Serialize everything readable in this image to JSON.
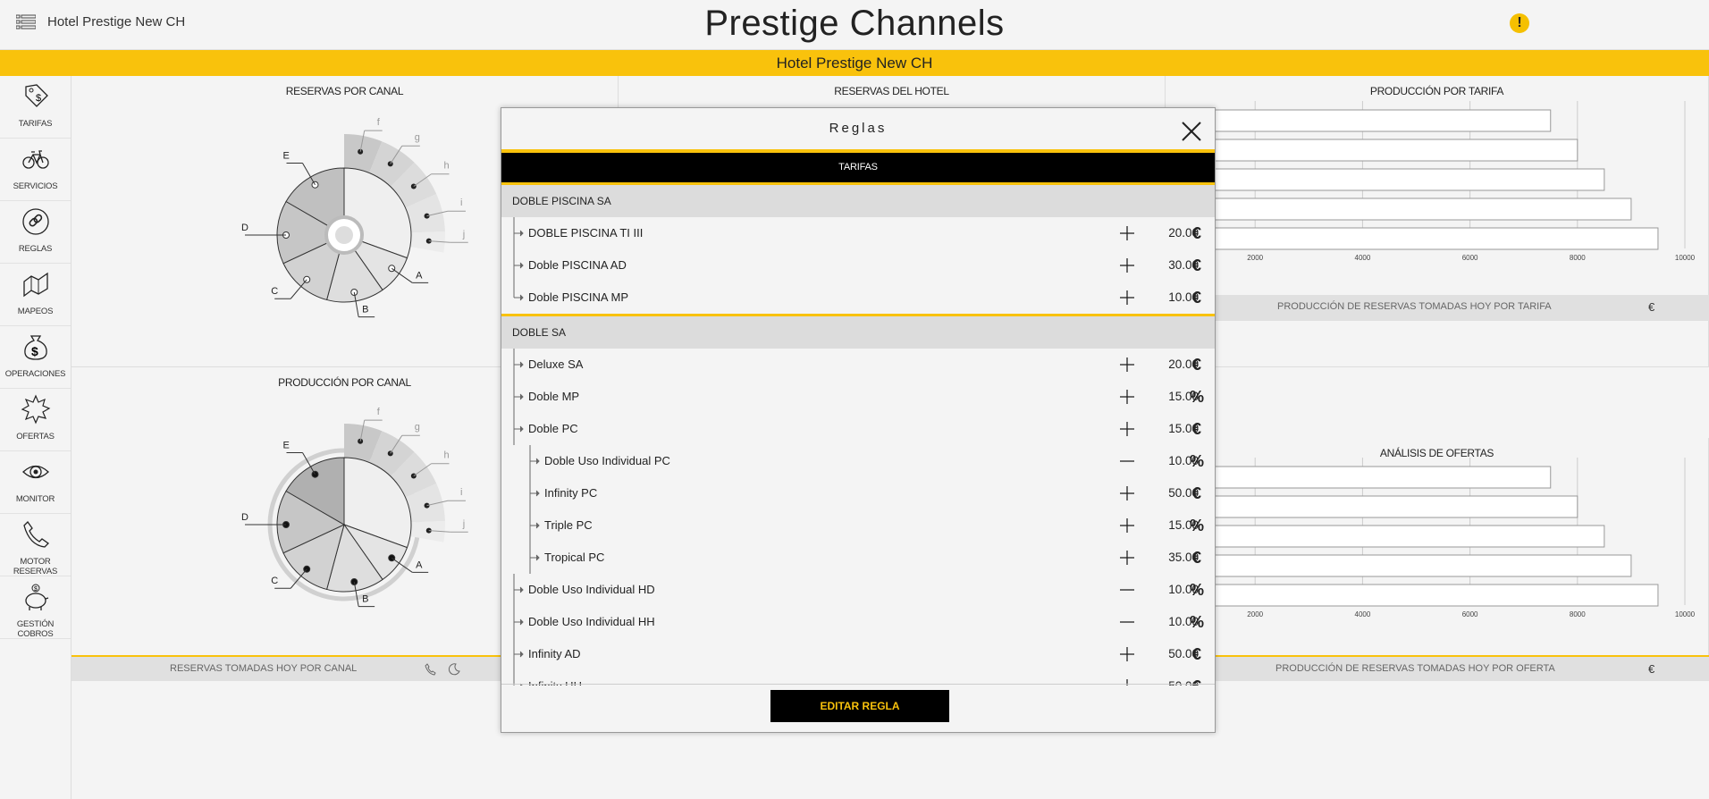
{
  "header": {
    "hotel": "Hotel Prestige New CH",
    "app_title": "Prestige Channels",
    "band_hotel": "Hotel Prestige New CH"
  },
  "sidebar": {
    "items": [
      {
        "label": "TARIFAS",
        "icon": "price-tag-icon"
      },
      {
        "label": "SERVICIOS",
        "icon": "bicycle-icon"
      },
      {
        "label": "REGLAS",
        "icon": "link-icon"
      },
      {
        "label": "MAPEOS",
        "icon": "map-icon"
      },
      {
        "label": "OPERACIONES",
        "icon": "money-bag-icon"
      },
      {
        "label": "OFERTAS",
        "icon": "burst-icon"
      },
      {
        "label": "MONITOR",
        "icon": "eye-icon"
      },
      {
        "label": "MOTOR RESERVAS",
        "icon": "phone-icon"
      },
      {
        "label": "GESTIÓN COBROS",
        "icon": "piggy-bank-icon"
      }
    ]
  },
  "panels": {
    "reservas_canal": "RESERVAS POR CANAL",
    "reservas_hotel": "RESERVAS DEL HOTEL",
    "produccion_tarifa": "PRODUCCIÓN POR TARIFA",
    "produccion_canal": "PRODUCCIÓN POR CANAL",
    "analisis_ofertas": "ANÁLISIS DE OFERTAS",
    "footer_canal": "RESERVAS TOMADAS HOY POR CANAL",
    "footer_tarifa": "PRODUCCIÓN DE RESERVAS TOMADAS HOY POR TARIFA",
    "footer_oferta": "PRODUCCIÓN DE RESERVAS TOMADAS HOY POR OFERTA",
    "euro": "€"
  },
  "pie_labels": [
    "A",
    "B",
    "C",
    "D",
    "E",
    "f",
    "g",
    "h",
    "i",
    "j"
  ],
  "axis_ticks": [
    "2000",
    "4000",
    "6000",
    "8000",
    "10000"
  ],
  "tarifa_bars": [
    7500,
    8000,
    8500,
    9000,
    9500
  ],
  "oferta_bars": [
    7500,
    8000,
    8500,
    9000,
    9500
  ],
  "modal": {
    "title": "Reglas",
    "tab": "TARIFAS",
    "edit_button": "EDITAR REGLA",
    "groups": [
      {
        "name": "DOBLE PISCINA SA",
        "rows": [
          {
            "name": "DOBLE PISCINA TI III",
            "sign": "+",
            "value": "20.00",
            "unit": "€",
            "level": 1
          },
          {
            "name": "Doble PISCINA AD",
            "sign": "+",
            "value": "30.00",
            "unit": "€",
            "level": 1
          },
          {
            "name": "Doble PISCINA MP",
            "sign": "+",
            "value": "10.00",
            "unit": "€",
            "level": 1
          }
        ]
      },
      {
        "name": "DOBLE SA",
        "rows": [
          {
            "name": "Deluxe SA",
            "sign": "+",
            "value": "20.00",
            "unit": "€",
            "level": 1
          },
          {
            "name": "Doble MP",
            "sign": "+",
            "value": "15.00",
            "unit": "%",
            "level": 1
          },
          {
            "name": "Doble PC",
            "sign": "+",
            "value": "15.00",
            "unit": "€",
            "level": 1
          },
          {
            "name": "Doble Uso Individual PC",
            "sign": "-",
            "value": "10.00",
            "unit": "%",
            "level": 2
          },
          {
            "name": "Infinity PC",
            "sign": "+",
            "value": "50.00",
            "unit": "€",
            "level": 2
          },
          {
            "name": "Triple PC",
            "sign": "+",
            "value": "15.00",
            "unit": "%",
            "level": 2
          },
          {
            "name": "Tropical PC",
            "sign": "+",
            "value": "35.00",
            "unit": "€",
            "level": 2
          },
          {
            "name": "Doble Uso Individual HD",
            "sign": "-",
            "value": "10.00",
            "unit": "%",
            "level": 1
          },
          {
            "name": "Doble Uso Individual HH",
            "sign": "-",
            "value": "10.00",
            "unit": "%",
            "level": 1
          },
          {
            "name": "Infinity AD",
            "sign": "+",
            "value": "50.00",
            "unit": "€",
            "level": 1
          },
          {
            "name": "Infinity HH",
            "sign": "+",
            "value": "50.00",
            "unit": "€",
            "level": 1
          }
        ]
      }
    ]
  }
}
